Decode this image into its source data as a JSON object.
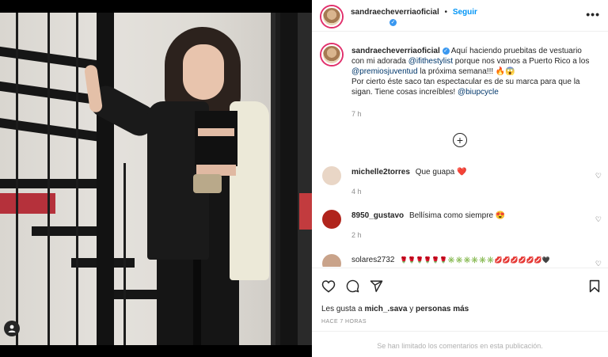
{
  "post": {
    "username": "sandraecheverriaoficial",
    "verified": true,
    "follow_label": "Seguir",
    "more_label": "•••",
    "dot": "•"
  },
  "caption": {
    "username": "sandraecheverriaoficial",
    "part1": " Aquí haciendo pruebitas de vestuario con mi adorada ",
    "mention1": "@ifithestylist",
    "part2": " porque nos vamos a Puerto Rico a los ",
    "mention2": "@premiosjuventud",
    "part3": " la próxima semana!!! 🔥😱",
    "part4": "Por cierto éste saco tan espectacular es de su marca para que la sigan. Tiene cosas increíbles! ",
    "mention3": "@biupcycle",
    "time": "7 h"
  },
  "load_more_label": "+",
  "comments": [
    {
      "username": "michelle2torres",
      "text": "Que guapa ❤️",
      "time": "4 h",
      "avatar_color": "#e9d6c6"
    },
    {
      "username": "8950_gustavo",
      "text": "Bellísima como siempre 😍",
      "time": "2 h",
      "avatar_color": "#b0241c"
    },
    {
      "username": "solares2732",
      "text": "🌹🌹🌹🌹🌹🌹✳️✳️✳️✳️✳️✳️💋💋💋💋💋💋🖤",
      "time": "",
      "avatar_color": "#c9a38a"
    }
  ],
  "likes": {
    "prefix": "Les gusta a ",
    "user": "mich_.sava",
    "joiner": " y ",
    "others": "personas más"
  },
  "posted_ago": "HACE 7 HORAS",
  "comments_limited": "Se han limitado los comentarios en esta publicación.",
  "icons": {
    "like": "heart-icon",
    "comment": "comment-icon",
    "share": "share-icon",
    "save": "bookmark-icon",
    "tagged": "user-tag-icon"
  },
  "colors": {
    "link": "#00376b",
    "follow": "#0095f6",
    "verified": "#3897f0",
    "story_ring": "#e1306c"
  }
}
